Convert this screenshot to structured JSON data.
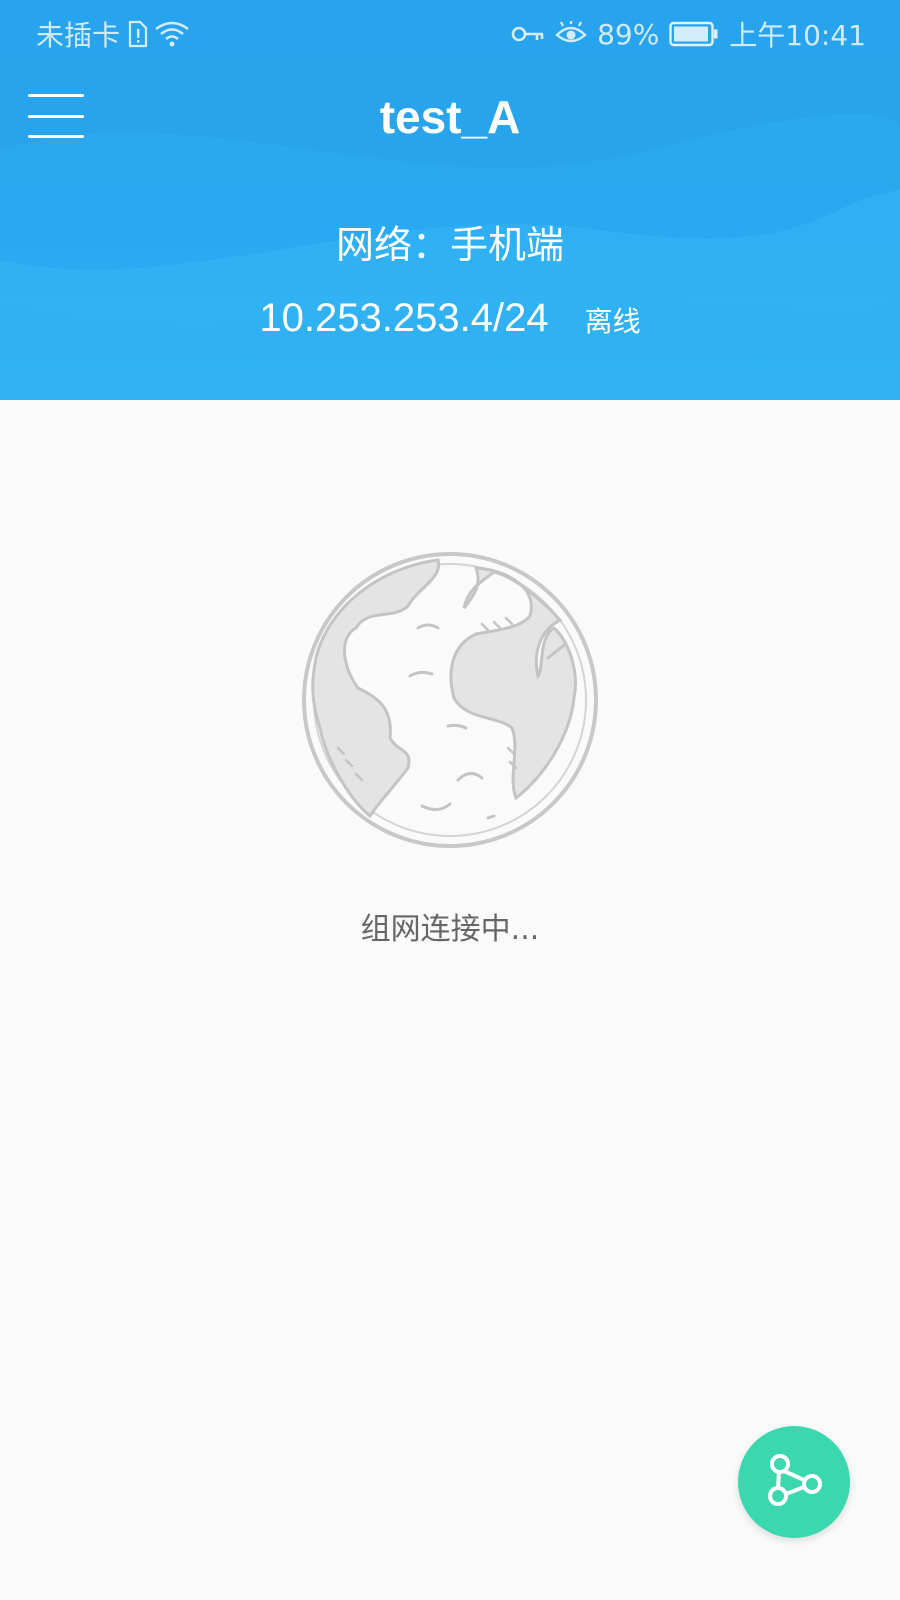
{
  "status_bar": {
    "carrier": "未插卡",
    "battery_percent": "89%",
    "time": "上午10:41",
    "icons": [
      "sim-card-icon",
      "wifi-icon",
      "vpn-key-icon",
      "eye-icon",
      "battery-icon"
    ]
  },
  "header": {
    "title": "test_A",
    "network_label": "网络：手机端",
    "ip_address": "10.253.253.4/24",
    "connection_status": "离线",
    "menu_icon": "menu-icon"
  },
  "main": {
    "illustration": "globe-icon",
    "connecting_text": "组网连接中..."
  },
  "fab": {
    "icon": "network-share-icon",
    "color": "#3bd8b0"
  },
  "colors": {
    "header_blue": "#2aa7ef",
    "background": "#fafafa",
    "fab_green": "#3bd8b0"
  }
}
